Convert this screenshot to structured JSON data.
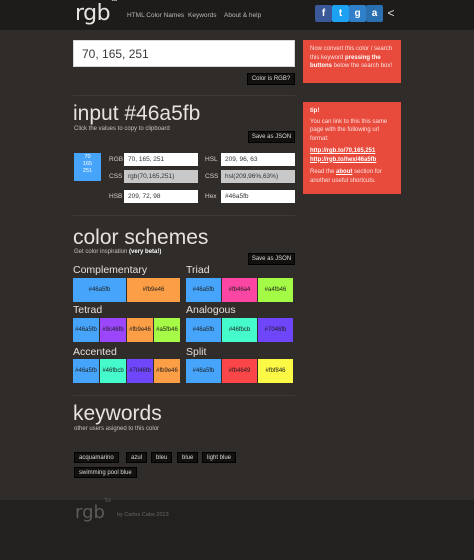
{
  "header": {
    "logo": "rgb",
    "logo_sup": "to",
    "nav": [
      "HTML Color Names",
      "Keywords",
      "About & help"
    ],
    "social": [
      {
        "icon": "facebook-icon",
        "glyph": "f",
        "color": "#3b5998"
      },
      {
        "icon": "twitter-icon",
        "glyph": "t",
        "color": "#1da1f2"
      },
      {
        "icon": "google-plus-icon",
        "glyph": "g",
        "color": "#2f80c9"
      },
      {
        "icon": "tumblr-icon",
        "glyph": "a",
        "color": "#2a6fb0"
      }
    ],
    "share_icon": "share-icon"
  },
  "search": {
    "value": "70, 165, 251",
    "is_rgb_label": "Color is RGB?"
  },
  "info_card_1": {
    "text_a": "Now convert this color / search this keyword ",
    "text_b": "pressing the buttons",
    "text_c": " below the search box!"
  },
  "info_card_2": {
    "tip": "tip!",
    "line1": "You can link to this this same page with the following url format:",
    "link1": "http://rgb.to/70,165,251",
    "link2": "http://rgb.to/hex/46a5fb",
    "read_a": "Read the ",
    "read_link": "about",
    "read_b": " section for another useful shortcuts."
  },
  "input_section": {
    "title": "input #46a5fb",
    "subtitle": "Click the values to copy to clipboard",
    "save_json": "Save as JSON",
    "swatch_lines": [
      "70",
      "165",
      "251"
    ],
    "swatch_color": "#46a5fb",
    "fields": {
      "rgb_label": "RGB",
      "rgb_value": "70, 165, 251",
      "hsl_label": "HSL",
      "hsl_value": "209, 96, 63",
      "css1_label": "CSS",
      "css1_value": "rgb(70,165,251)",
      "css2_label": "CSS",
      "css2_value": "hsl(209,96%,63%)",
      "hsb_label": "HSB",
      "hsb_value": "209, 72, 98",
      "hex_label": "Hex",
      "hex_value": "#46a5fb"
    }
  },
  "schemes": {
    "title": "color schemes",
    "subtitle_a": "Get color inspiration ",
    "subtitle_b": "(very beta!)",
    "save_json": "Save as JSON",
    "complementary": {
      "title": "Complementary",
      "swatches": [
        {
          "label": "#46a5fb",
          "color": "#46a5fb"
        },
        {
          "label": "#fb9e46",
          "color": "#fb9e46"
        }
      ]
    },
    "triad": {
      "title": "Triad",
      "swatches": [
        {
          "label": "#46a5fb",
          "color": "#46a5fb"
        },
        {
          "label": "#fb46a4",
          "color": "#fb46a4"
        },
        {
          "label": "#a4fb46",
          "color": "#a4fb46"
        }
      ]
    },
    "tetrad": {
      "title": "Tetrad",
      "swatches": [
        {
          "label": "#46a5fb",
          "color": "#46a5fb"
        },
        {
          "label": "#9c46fb",
          "color": "#9c46fb"
        },
        {
          "label": "#fb9e46",
          "color": "#fb9e46"
        },
        {
          "label": "#a5fb46",
          "color": "#a5fb46"
        }
      ]
    },
    "analogous": {
      "title": "Analogous",
      "swatches": [
        {
          "label": "#46a5fb",
          "color": "#46a5fb"
        },
        {
          "label": "#46fbcb",
          "color": "#46fbcb"
        },
        {
          "label": "#7046fb",
          "color": "#7046fb"
        }
      ]
    },
    "accented": {
      "title": "Accented",
      "swatches": [
        {
          "label": "#46a5fb",
          "color": "#46a5fb"
        },
        {
          "label": "#46fbcb",
          "color": "#46fbcb"
        },
        {
          "label": "#7046fb",
          "color": "#7046fb"
        },
        {
          "label": "#fb9e46",
          "color": "#fb9e46"
        }
      ]
    },
    "split": {
      "title": "Split",
      "swatches": [
        {
          "label": "#46a5fb",
          "color": "#46a5fb"
        },
        {
          "label": "#fb4649",
          "color": "#fb4649"
        },
        {
          "label": "#fbf846",
          "color": "#fbf846"
        }
      ]
    }
  },
  "keywords": {
    "title": "keywords",
    "subtitle": "other users asigned to this color",
    "tags": [
      "acquamarino",
      "azul",
      "bleu",
      "blue",
      "light blue",
      "swimming pool blue"
    ]
  },
  "footer": {
    "logo": "rgb",
    "logo_sup": "to",
    "text": "by Carlos Cabo 2013"
  }
}
